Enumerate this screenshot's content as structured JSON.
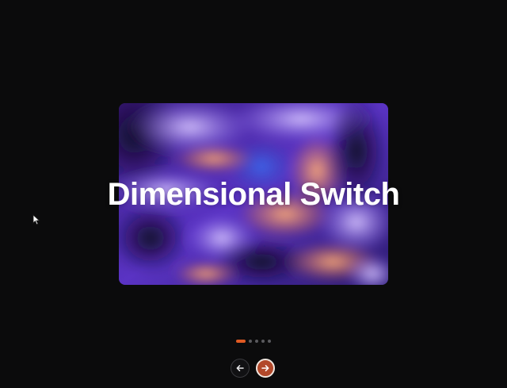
{
  "slide": {
    "title": "Dimensional Switch",
    "image_icon": "abstract-fluid-artwork"
  },
  "pagination": {
    "total": 5,
    "active_index": 0,
    "active_color": "#e05a23",
    "inactive_color": "#5a5a5e"
  },
  "controls": {
    "prev_icon": "arrow-left-icon",
    "next_icon": "arrow-right-icon",
    "next_color": "#b2482a"
  },
  "colors": {
    "background": "#0b0b0c",
    "accent": "#e05a23"
  }
}
